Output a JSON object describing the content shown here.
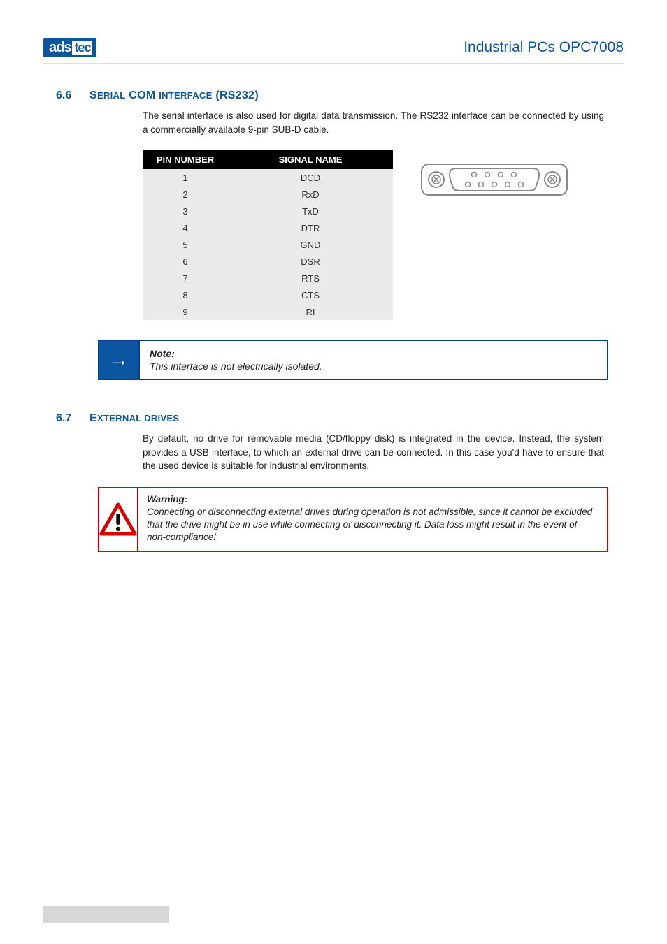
{
  "header": {
    "logo": {
      "ads": "ads",
      "tec": "tec"
    },
    "title": "Industrial PCs OPC7008"
  },
  "section_serial": {
    "number": "6.6",
    "title_pre": "S",
    "title_caps": "ERIAL",
    "title_mid": " COM ",
    "title_caps2": "INTERFACE",
    "title_post": " (RS232)",
    "intro": "The serial interface is also used for digital data transmission. The RS232 interface can be connected by using a commercially available 9-pin SUB-D cable."
  },
  "pin_table": {
    "headers": {
      "pin": "PIN NUMBER",
      "signal": "SIGNAL NAME"
    },
    "rows": [
      {
        "pin": "1",
        "signal": "DCD"
      },
      {
        "pin": "2",
        "signal": "RxD"
      },
      {
        "pin": "3",
        "signal": "TxD"
      },
      {
        "pin": "4",
        "signal": "DTR"
      },
      {
        "pin": "5",
        "signal": "GND"
      },
      {
        "pin": "6",
        "signal": "DSR"
      },
      {
        "pin": "7",
        "signal": "RTS"
      },
      {
        "pin": "8",
        "signal": "CTS"
      },
      {
        "pin": "9",
        "signal": "RI"
      }
    ]
  },
  "note_block": {
    "title": "Note:",
    "body": "This interface is not electrically isolated.",
    "arrow": "→"
  },
  "section_ext": {
    "number": "6.7",
    "title_pre": "E",
    "title_caps": "XTERNAL DRIVES",
    "intro": "By default, no drive for removable media (CD/floppy disk) is integrated in the device. Instead, the system provides a USB interface, to which an external drive can be connected. In this case you'd have to ensure that the used device is suitable for industrial environments."
  },
  "warn_block": {
    "title": "Warning:",
    "body": "Connecting or disconnecting external drives during operation is not admissible, since it cannot be excluded that the drive might be in use while connecting or disconnecting it. Data loss might result in the event of non-compliance!"
  }
}
